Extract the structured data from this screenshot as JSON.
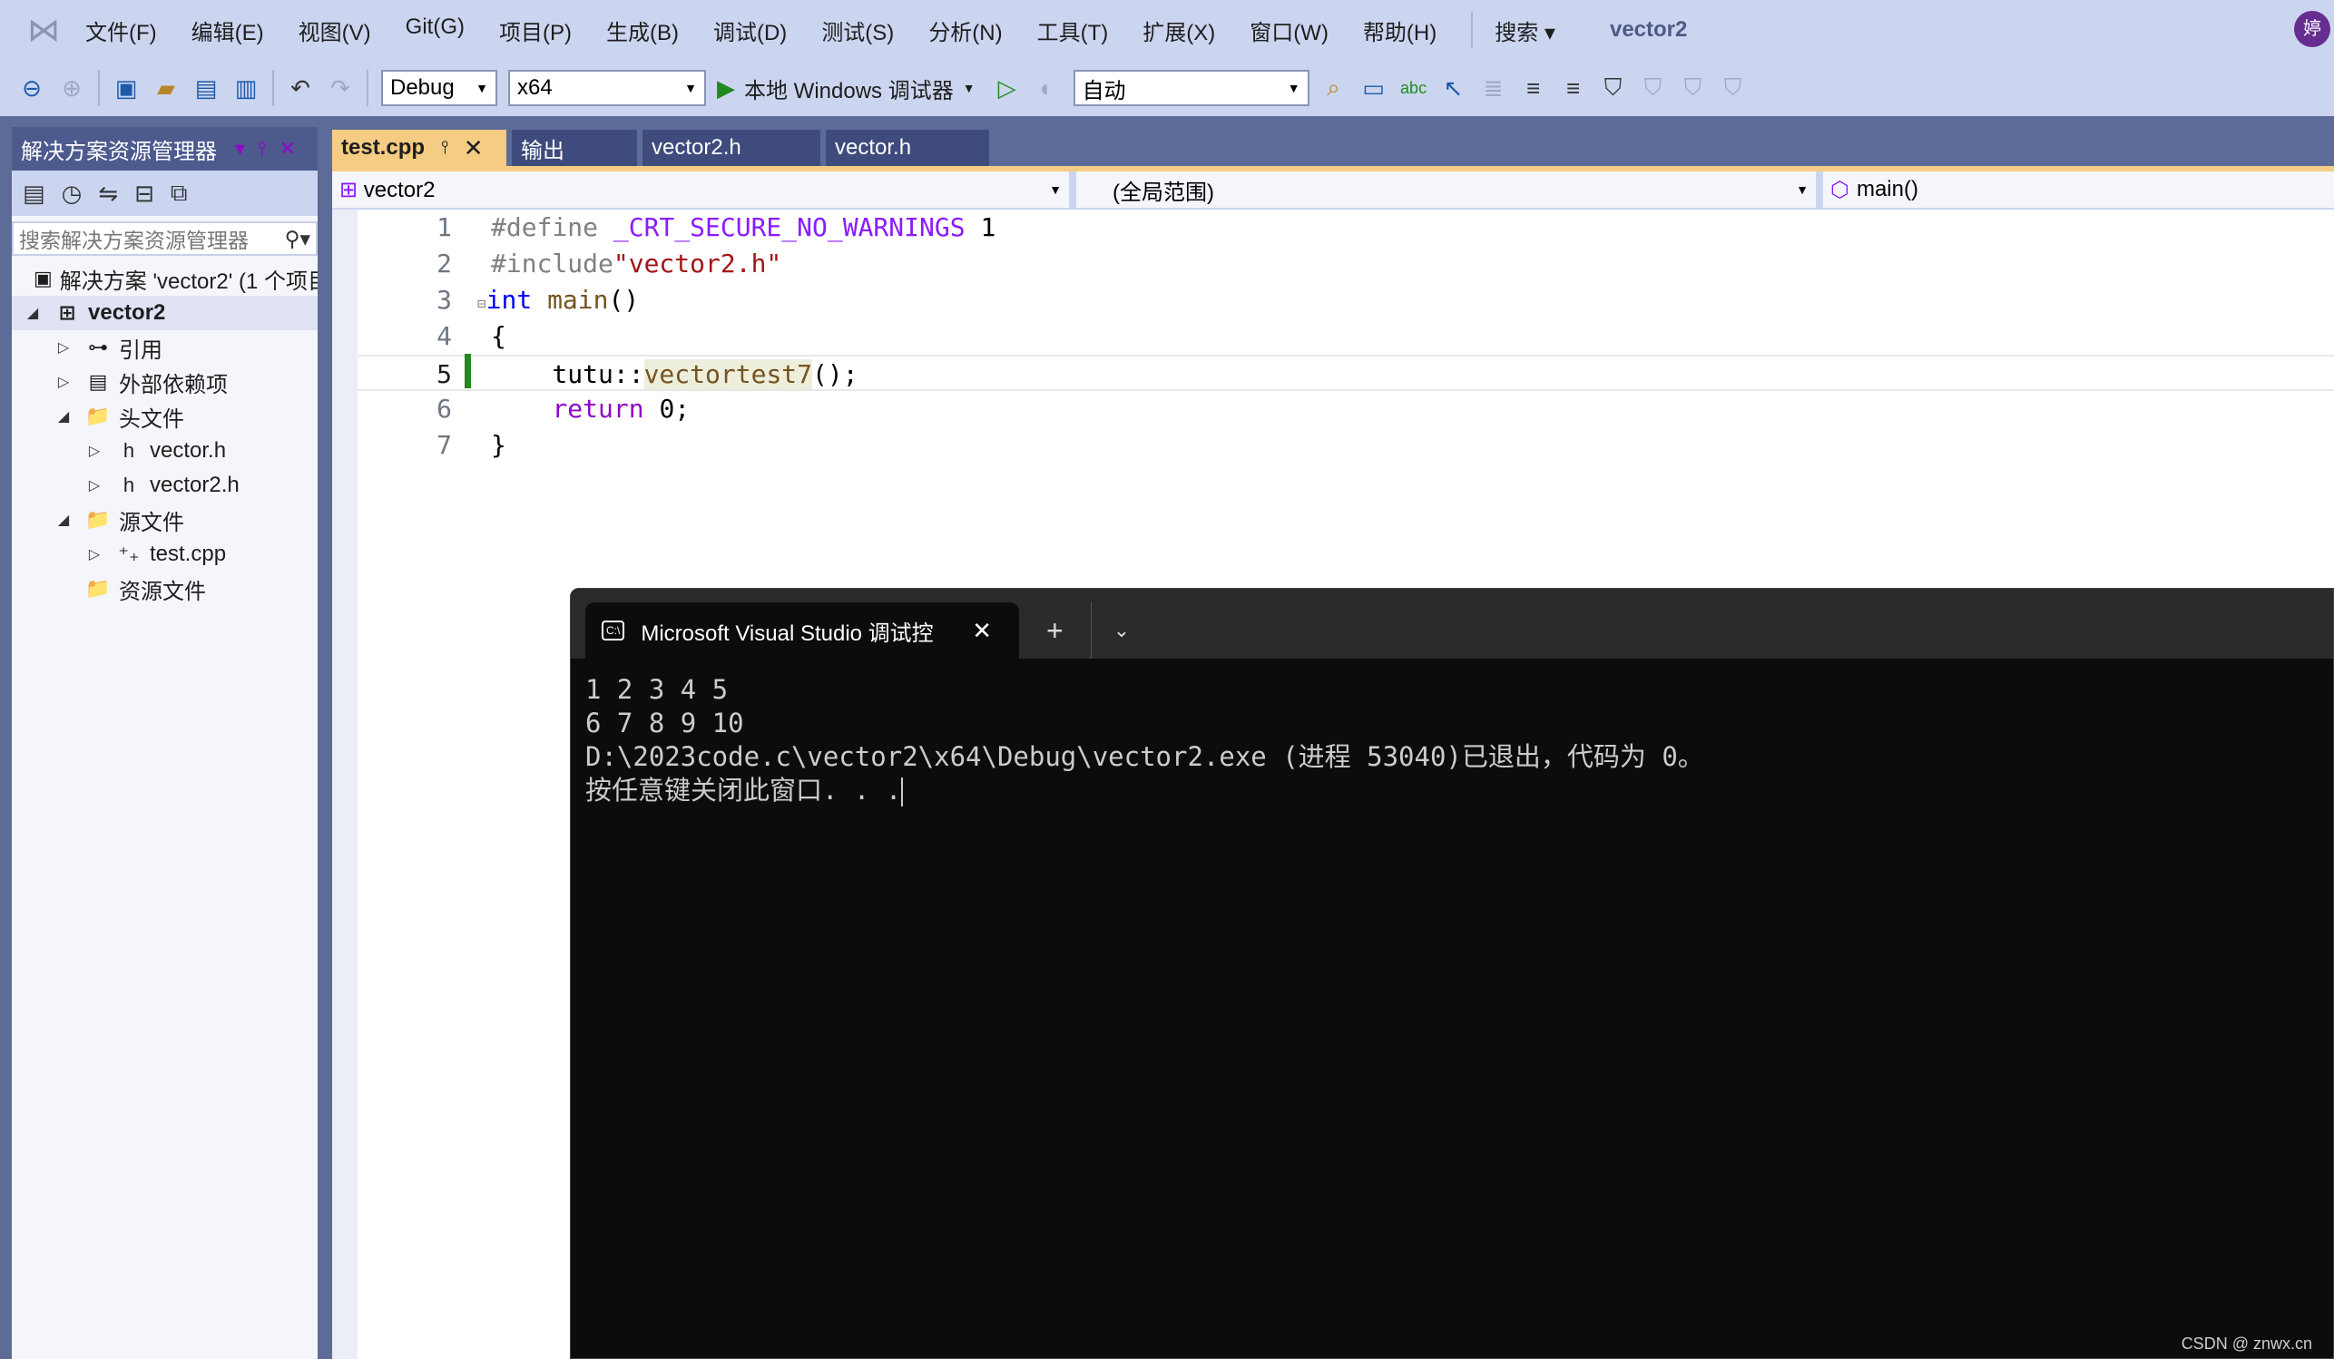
{
  "menubar": {
    "items": [
      "文件(F)",
      "编辑(E)",
      "视图(V)",
      "Git(G)",
      "项目(P)",
      "生成(B)",
      "调试(D)",
      "测试(S)",
      "分析(N)",
      "工具(T)",
      "扩展(X)",
      "窗口(W)",
      "帮助(H)"
    ],
    "search": "搜索 ▾",
    "title": "vector2",
    "avatar": "婷"
  },
  "toolbar": {
    "config": "Debug",
    "platform": "x64",
    "run": "本地 Windows 调试器",
    "auto": "自动"
  },
  "sidebar": {
    "title": "解决方案资源管理器",
    "search_placeholder": "搜索解决方案资源管理器",
    "tree": [
      {
        "label": "解决方案 'vector2' (1 个项目",
        "tw": "",
        "icon": "▣",
        "indent": 0
      },
      {
        "label": "vector2",
        "tw": "◢",
        "icon": "⊞",
        "indent": 0,
        "sel": true
      },
      {
        "label": "引用",
        "tw": "▷",
        "icon": "⊶",
        "indent": 1
      },
      {
        "label": "外部依赖项",
        "tw": "▷",
        "icon": "▤",
        "indent": 1
      },
      {
        "label": "头文件",
        "tw": "◢",
        "icon": "📁",
        "indent": 1
      },
      {
        "label": "vector.h",
        "tw": "▷",
        "icon": "h",
        "indent": 2
      },
      {
        "label": "vector2.h",
        "tw": "▷",
        "icon": "h",
        "indent": 2
      },
      {
        "label": "源文件",
        "tw": "◢",
        "icon": "📁",
        "indent": 1
      },
      {
        "label": "test.cpp",
        "tw": "▷",
        "icon": "⁺₊",
        "indent": 2
      },
      {
        "label": "资源文件",
        "tw": "",
        "icon": "📁",
        "indent": 1
      }
    ]
  },
  "tabs": [
    {
      "label": "test.cpp",
      "active": true
    },
    {
      "label": "输出"
    },
    {
      "label": "vector2.h"
    },
    {
      "label": "vector.h"
    }
  ],
  "navbar": {
    "project": "vector2",
    "scope": "(全局范围)",
    "member": "main()"
  },
  "editor": {
    "lines": [
      "1",
      "2",
      "3",
      "4",
      "5",
      "6",
      "7"
    ]
  },
  "terminal": {
    "tab_title": "Microsoft Visual Studio 调试控",
    "lines": [
      "1 2 3 4 5",
      "6 7 8 9 10",
      "D:\\2023code.c\\vector2\\x64\\Debug\\vector2.exe (进程 53040)已退出，代码为 0。",
      "按任意键关闭此窗口. . ."
    ]
  },
  "watermark": "CSDN @ znwx.cn"
}
